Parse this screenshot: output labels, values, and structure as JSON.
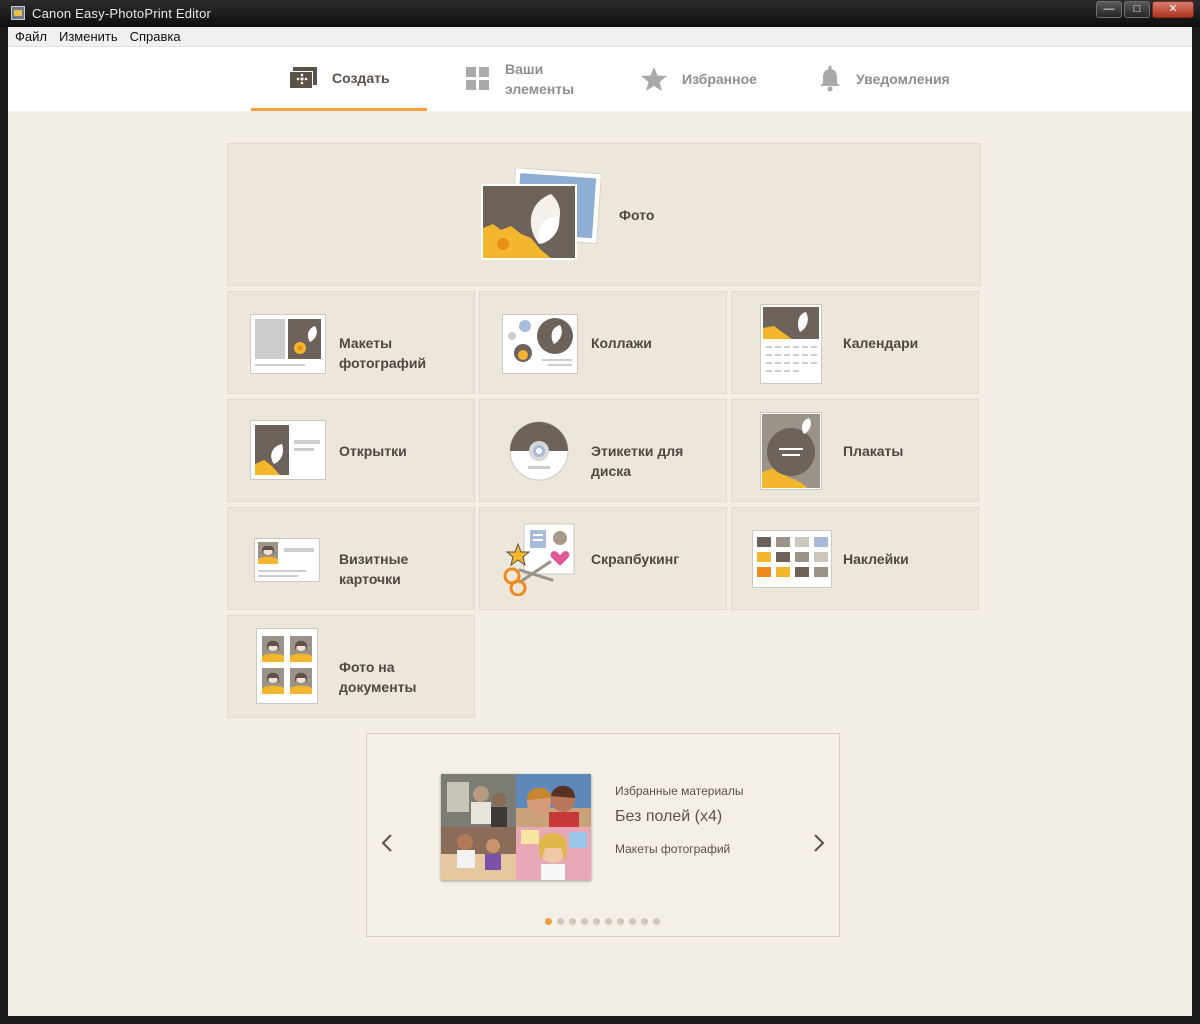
{
  "window": {
    "title": "Canon Easy-PhotoPrint Editor",
    "minimize_glyph": "—",
    "maximize_glyph": "□",
    "close_glyph": "✕"
  },
  "menu": {
    "items": [
      "Файл",
      "Изменить",
      "Справка"
    ]
  },
  "tabs": [
    {
      "label": "Создать",
      "icon": "create-icon",
      "active": true
    },
    {
      "label": "Ваши\nэлементы",
      "icon": "grid-icon",
      "active": false
    },
    {
      "label": "Избранное",
      "icon": "star-icon",
      "active": false
    },
    {
      "label": "Уведомления",
      "icon": "bell-icon",
      "active": false
    }
  ],
  "tiles": {
    "photo": "Фото",
    "layouts": "Макеты\nфотографий",
    "collages": "Коллажи",
    "calendars": "Календари",
    "cards": "Открытки",
    "disc_labels": "Этикетки для\nдиска",
    "posters": "Плакаты",
    "business_cards": "Визитные\nкарточки",
    "scrapbooking": "Скрапбукинг",
    "stickers": "Наклейки",
    "id_photos": "Фото на\nдокументы"
  },
  "carousel": {
    "category": "Избранные материалы",
    "name": "Без полей (x4)",
    "type": "Макеты фотографий",
    "dot_count": 10,
    "active_dot": 0
  },
  "colors": {
    "accent": "#f0a040",
    "tile_bg": "#ede6da",
    "text_dark": "#4f4842",
    "text_muted": "#8f8f8f"
  }
}
